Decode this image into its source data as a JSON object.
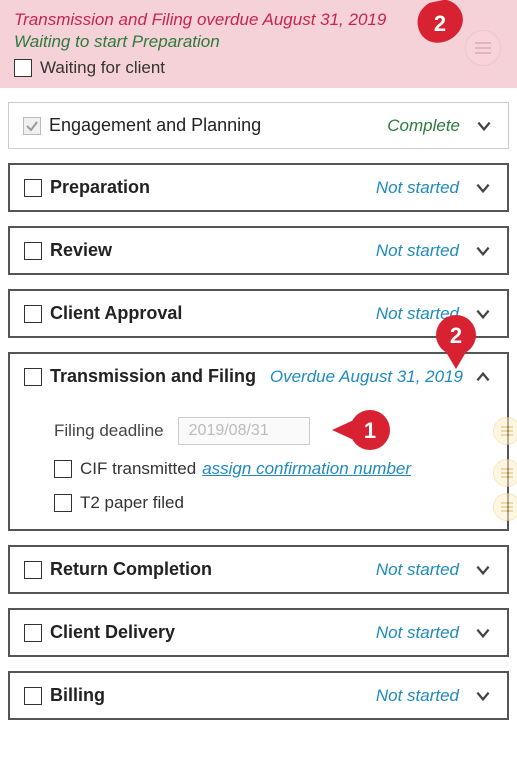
{
  "alert": {
    "overdue_line": "Transmission and Filing overdue August 31, 2019",
    "waiting_line": "Waiting to start Preparation",
    "waiting_for_client": "Waiting for client"
  },
  "sections": {
    "engagement": {
      "title": "Engagement and Planning",
      "status": "Complete"
    },
    "preparation": {
      "title": "Preparation",
      "status": "Not started"
    },
    "review": {
      "title": "Review",
      "status": "Not started"
    },
    "client_approval": {
      "title": "Client Approval",
      "status": "Not started"
    },
    "transmission": {
      "title": "Transmission and Filing",
      "status": "Overdue August 31, 2019",
      "deadline_label": "Filing deadline",
      "deadline_value": "2019/08/31",
      "cif_label": "CIF transmitted",
      "assign_link": "assign confirmation number",
      "paper_label": "T2 paper filed"
    },
    "return_completion": {
      "title": "Return Completion",
      "status": "Not started"
    },
    "client_delivery": {
      "title": "Client Delivery",
      "status": "Not started"
    },
    "billing": {
      "title": "Billing",
      "status": "Not started"
    }
  },
  "callouts": {
    "one": "1",
    "two": "2"
  }
}
